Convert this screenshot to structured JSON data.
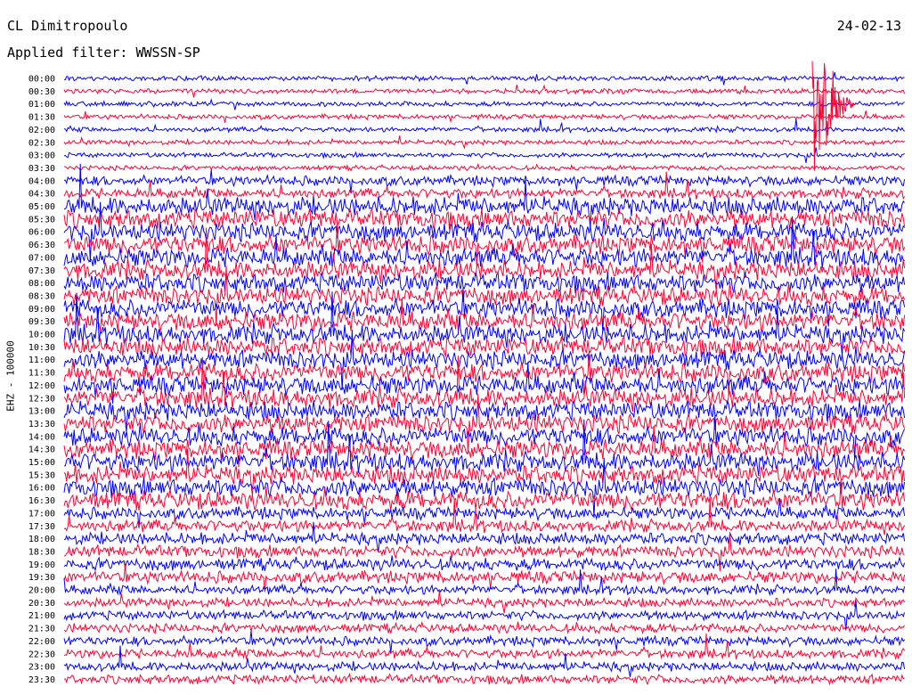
{
  "header": {
    "station": "CL Dimitropoulo",
    "filter": "Applied filter: WWSSN-SP",
    "date": "24-02-13"
  },
  "colors": {
    "even_trace": "#0000ff",
    "odd_trace": "#ff0033",
    "background": "#ffffff"
  },
  "chart_data": {
    "type": "line",
    "title": "",
    "ylabel": "EHZ - 100000",
    "xlabel": "",
    "row_labels": [
      "00:00",
      "00:30",
      "01:00",
      "01:30",
      "02:00",
      "02:30",
      "03:00",
      "03:30",
      "04:00",
      "04:30",
      "05:00",
      "05:30",
      "06:00",
      "06:30",
      "07:00",
      "07:30",
      "08:00",
      "08:30",
      "09:00",
      "09:30",
      "10:00",
      "10:30",
      "11:00",
      "11:30",
      "12:00",
      "12:30",
      "13:00",
      "13:30",
      "14:00",
      "14:30",
      "15:00",
      "15:30",
      "16:00",
      "16:30",
      "17:00",
      "17:30",
      "18:00",
      "18:30",
      "19:00",
      "19:30",
      "20:00",
      "20:30",
      "21:00",
      "21:30",
      "22:00",
      "22:30",
      "23:00",
      "23:30"
    ],
    "legend": "none",
    "grid": false
  }
}
